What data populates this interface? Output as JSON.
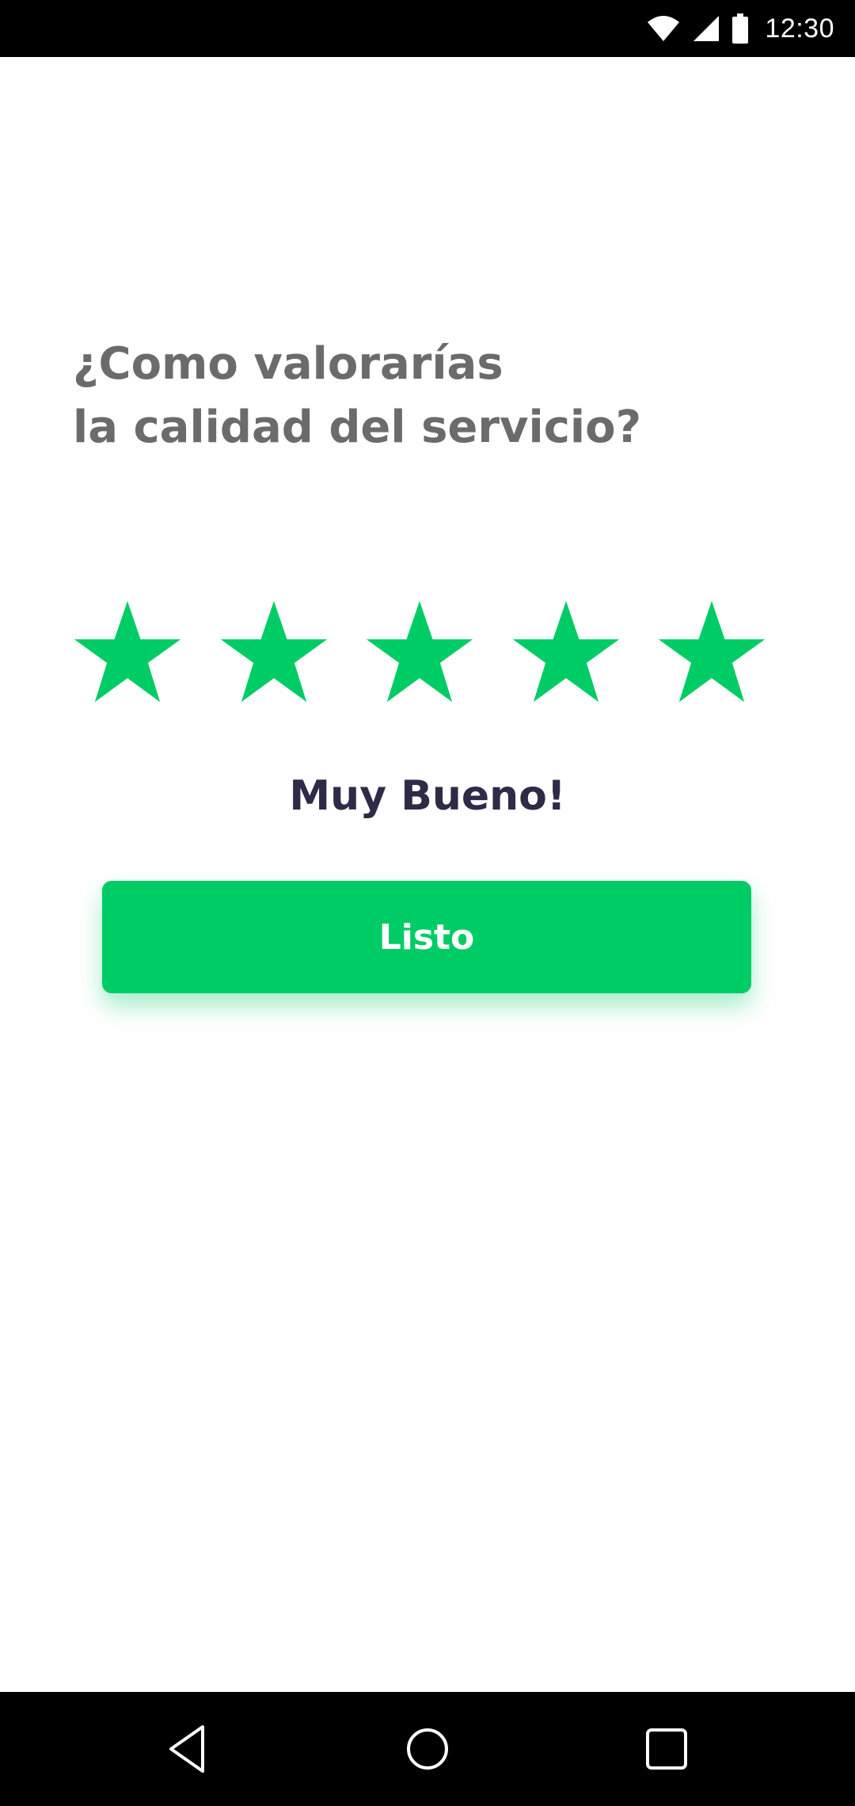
{
  "status_bar": {
    "time": "12:30",
    "icons": [
      "wifi-icon",
      "cellular-signal-icon",
      "battery-icon"
    ]
  },
  "rating_screen": {
    "question_line1": "¿Como valorarías",
    "question_line2": "la calidad del servicio?",
    "rating": 5,
    "max_rating": 5,
    "rating_label": "Muy Bueno!",
    "done_button_label": "Listo"
  },
  "colors": {
    "accent": "#00CC66",
    "question_text": "#6B6B6B",
    "rating_label_text": "#2E2A47",
    "bars": "#000000"
  },
  "nav_bar": {
    "icons": [
      "back-icon",
      "home-icon",
      "recents-icon"
    ]
  }
}
